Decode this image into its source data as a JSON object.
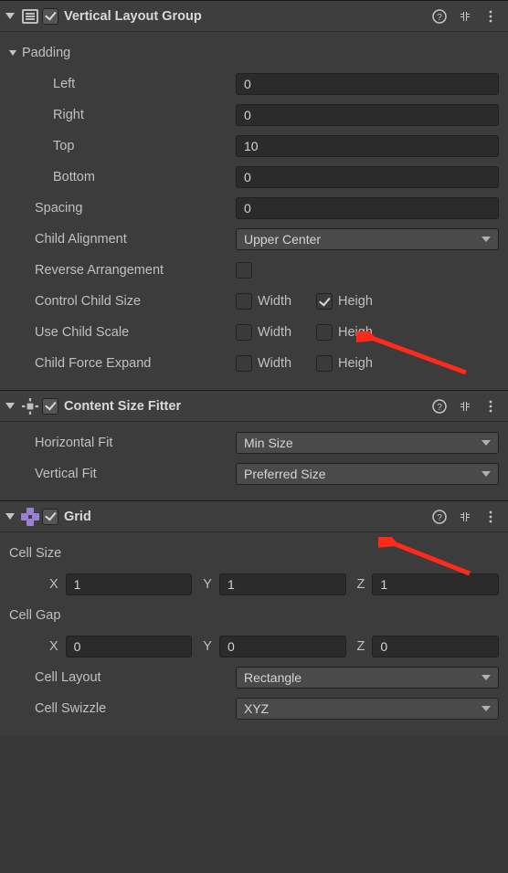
{
  "vlg": {
    "title": "Vertical Layout Group",
    "enabled": true,
    "padding": {
      "label": "Padding",
      "left_label": "Left",
      "left": "0",
      "right_label": "Right",
      "right": "0",
      "top_label": "Top",
      "top": "10",
      "bottom_label": "Bottom",
      "bottom": "0"
    },
    "spacing_label": "Spacing",
    "spacing": "0",
    "child_align_label": "Child Alignment",
    "child_align": "Upper Center",
    "reverse_label": "Reverse Arrangement",
    "reverse": false,
    "control_label": "Control Child Size",
    "use_scale_label": "Use Child Scale",
    "force_expand_label": "Child Force Expand",
    "width_label": "Width",
    "height_label": "Heigh",
    "control_width": false,
    "control_height": true,
    "scale_width": false,
    "scale_height": false,
    "expand_width": false,
    "expand_height": false
  },
  "csf": {
    "title": "Content Size Fitter",
    "enabled": true,
    "hfit_label": "Horizontal Fit",
    "hfit": "Min Size",
    "vfit_label": "Vertical Fit",
    "vfit": "Preferred Size"
  },
  "grid": {
    "title": "Grid",
    "enabled": true,
    "cell_size_label": "Cell Size",
    "cell_size": {
      "x": "1",
      "y": "1",
      "z": "1"
    },
    "cell_gap_label": "Cell Gap",
    "cell_gap": {
      "x": "0",
      "y": "0",
      "z": "0"
    },
    "axis": {
      "x": "X",
      "y": "Y",
      "z": "Z"
    },
    "layout_label": "Cell Layout",
    "layout": "Rectangle",
    "swizzle_label": "Cell Swizzle",
    "swizzle": "XYZ"
  }
}
